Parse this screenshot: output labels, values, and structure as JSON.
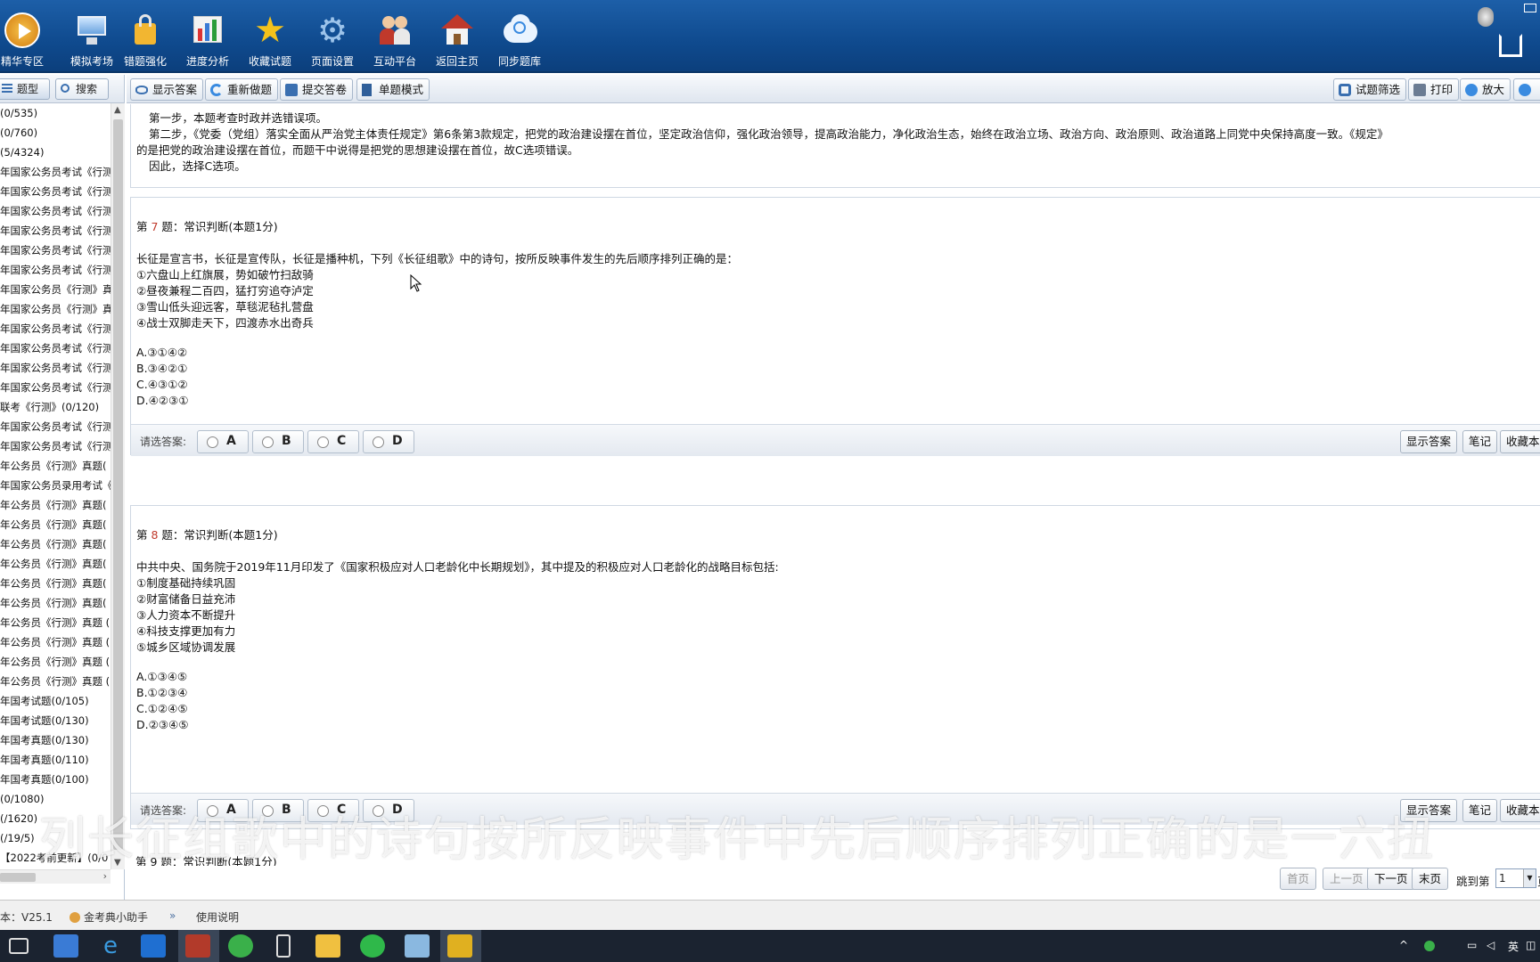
{
  "topbar": {
    "items": [
      {
        "label": "精华专区",
        "icon": "play-circle-icon"
      },
      {
        "label": "模拟考场",
        "icon": "monitor-icon"
      },
      {
        "label": "错题强化",
        "icon": "lock-chart-icon"
      },
      {
        "label": "进度分析",
        "icon": "bar-chart-icon"
      },
      {
        "label": "收藏试题",
        "icon": "star-icon"
      },
      {
        "label": "页面设置",
        "icon": "gear-icon"
      },
      {
        "label": "互动平台",
        "icon": "people-icon"
      },
      {
        "label": "返回主页",
        "icon": "home-icon"
      },
      {
        "label": "同步题库",
        "icon": "cloud-sync-icon"
      }
    ]
  },
  "left": {
    "tabs": [
      {
        "label": "题型",
        "icon": "list-icon"
      },
      {
        "label": "搜索",
        "icon": "search-icon"
      }
    ],
    "tree": [
      "(0/535)",
      "(0/760)",
      "(5/4324)",
      "年国家公务员考试《行测",
      "年国家公务员考试《行测",
      "年国家公务员考试《行测",
      "年国家公务员考试《行测",
      "年国家公务员考试《行测",
      "年国家公务员考试《行测",
      "年国家公务员《行测》真",
      "年国家公务员《行测》真",
      "年国家公务员考试《行测",
      "年国家公务员考试《行测",
      "年国家公务员考试《行测",
      "年国家公务员考试《行测",
      "联考《行测》(0/120)",
      "年国家公务员考试《行测",
      "年国家公务员考试《行测",
      "年公务员《行测》真题(",
      "年国家公务员录用考试《",
      "年公务员《行测》真题(",
      "年公务员《行测》真题(",
      "年公务员《行测》真题(",
      "年公务员《行测》真题(",
      "年公务员《行测》真题(",
      "年公务员《行测》真题(",
      "年公务员《行测》真题 (",
      "年公务员《行测》真题 (",
      "年公务员《行测》真题 (",
      "年公务员《行测》真题 (",
      "年国考试题(0/105)",
      "年国考试题(0/130)",
      "年国考真题(0/130)",
      "年国考真题(0/110)",
      "年国考真题(0/100)",
      "(0/1080)",
      "(/1620)",
      "(/19/5)",
      "【2022考前更新】(0/0"
    ]
  },
  "toolbar": {
    "left_buttons": [
      {
        "label": "显示答案",
        "icon": "eye-icon"
      },
      {
        "label": "重新做题",
        "icon": "refresh-icon"
      },
      {
        "label": "提交答卷",
        "icon": "submit-icon"
      },
      {
        "label": "单题模式",
        "icon": "document-icon"
      }
    ],
    "right_buttons": [
      {
        "label": "试题筛选",
        "icon": "filter-icon"
      },
      {
        "label": "打印",
        "icon": "printer-icon"
      },
      {
        "label": "放大",
        "icon": "zoom-in-icon"
      }
    ]
  },
  "explanation": {
    "lines": [
      "第一步，本题考查时政并选错误项。",
      "第二步，《党委（党组）落实全面从严治党主体责任规定》第6条第3款规定，把党的政治建设摆在首位，坚定政治信仰，强化政治领导，提高政治能力，净化政治生态，始终在政治立场、政治方向、政治原则、政治道路上同党中央保持高度一致。《规定》",
      "的是把党的政治建设摆在首位，而题干中说得是把党的思想建设摆在首位，故C选项错误。",
      "因此，选择C选项。"
    ]
  },
  "questions": [
    {
      "title_pre": "第 ",
      "number": "7",
      "title_post": " 题：常识判断(本题1分)",
      "stem": "长征是宣言书，长征是宣传队，长征是播种机，下列《长征组歌》中的诗句，按所反映事件发生的先后顺序排列正确的是：",
      "items": [
        "①六盘山上红旗展，势如破竹扫敌骑",
        "②昼夜兼程二百四，猛打穷追夺泸定",
        "③雪山低头迎远客，草毯泥毡扎营盘",
        "④战士双脚走天下，四渡赤水出奇兵"
      ],
      "options": [
        "A.③①④②",
        "B.③④②①",
        "C.④③①②",
        "D.④②③①"
      ]
    },
    {
      "title_pre": "第 ",
      "number": "8",
      "title_post": " 题：常识判断(本题1分)",
      "stem": "中共中央、国务院于2019年11月印发了《国家积极应对人口老龄化中长期规划》，其中提及的积极应对人口老龄化的战略目标包括:",
      "items": [
        "①制度基础持续巩固",
        "②财富储备日益充沛",
        "③人力资本不断提升",
        "④科技支撑更加有力",
        "⑤城乡区域协调发展"
      ],
      "options": [
        "A.①③④⑤",
        "B.①②③④",
        "C.①②④⑤",
        "D.②③④⑤"
      ]
    }
  ],
  "answer_bar": {
    "prompt": "请选答案:",
    "choices": [
      "A",
      "B",
      "C",
      "D"
    ],
    "show_answer": "显示答案",
    "notes": "笔记",
    "favorite": "收藏本"
  },
  "next_question_peek": "第 9 题：常识判断(本题1分)",
  "subtitle": "列长征组歌中的诗句按所反映事件中先后顺序排列正确的是一六扭",
  "pager": {
    "first": "首页",
    "prev": "上一页",
    "next": "下一页",
    "last": "末页",
    "jump_label": "跳到第",
    "jump_value": "1",
    "suffix": "页"
  },
  "status": {
    "version": "本：V25.1",
    "helper": "金考典小助手",
    "guide": "使用说明"
  },
  "tray": {
    "ime": "英"
  },
  "colors": {
    "topbar": "#0f4a8e",
    "question_number": "#c0392b",
    "taskbar": "#1b2330"
  }
}
